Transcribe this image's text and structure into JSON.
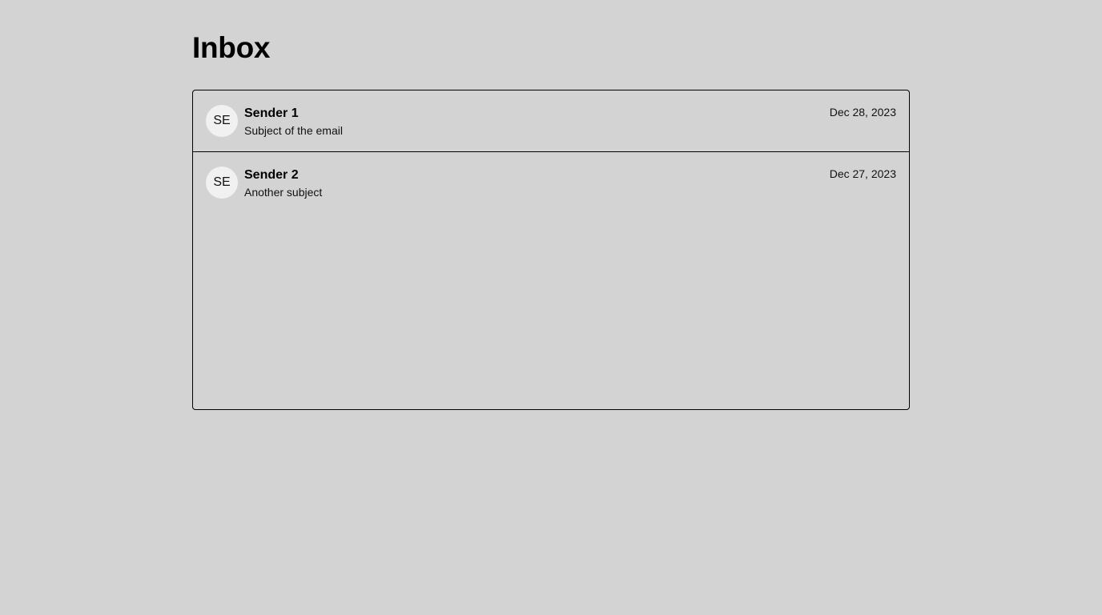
{
  "header": {
    "title": "Inbox"
  },
  "emails": [
    {
      "avatar_initials": "SE",
      "sender": "Sender 1",
      "subject": "Subject of the email",
      "date": "Dec 28, 2023"
    },
    {
      "avatar_initials": "SE",
      "sender": "Sender 2",
      "subject": "Another subject",
      "date": "Dec 27, 2023"
    }
  ],
  "colors": {
    "background": "#d3d3d3",
    "avatar_bg": "#f1f1f1",
    "border": "#000000"
  }
}
